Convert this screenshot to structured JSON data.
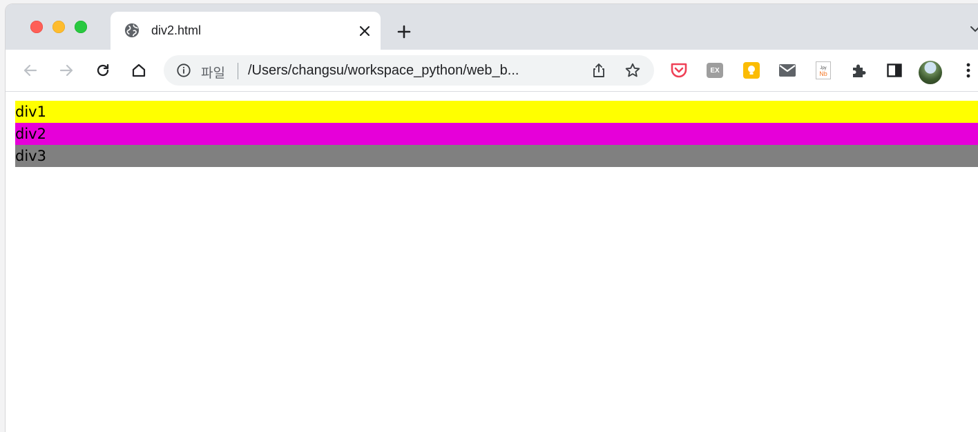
{
  "browser": {
    "tab": {
      "title": "div2.html"
    },
    "address_bar": {
      "scheme_label": "파일",
      "url": "/Users/changsu/workspace_python/web_b..."
    },
    "extensions": [
      {
        "name": "pocket-icon",
        "color": "#ef4056"
      },
      {
        "name": "ex-extension-icon",
        "label": "EX",
        "color": "#9e9e9e"
      },
      {
        "name": "google-keep-icon",
        "color": "#fbbc04"
      },
      {
        "name": "mail-icon",
        "color": "#5f6368"
      },
      {
        "name": "jupyter-notebook-icon",
        "label": "Nb",
        "sublabel": "Jpy"
      },
      {
        "name": "puzzle-extensions-icon",
        "color": "#5f6368"
      },
      {
        "name": "side-panel-icon",
        "color": "#202124"
      }
    ]
  },
  "page": {
    "divs": [
      {
        "text": "div1",
        "color": "#ffff00"
      },
      {
        "text": "div2",
        "color": "#e600d9"
      },
      {
        "text": "div3",
        "color": "#808080"
      }
    ]
  }
}
